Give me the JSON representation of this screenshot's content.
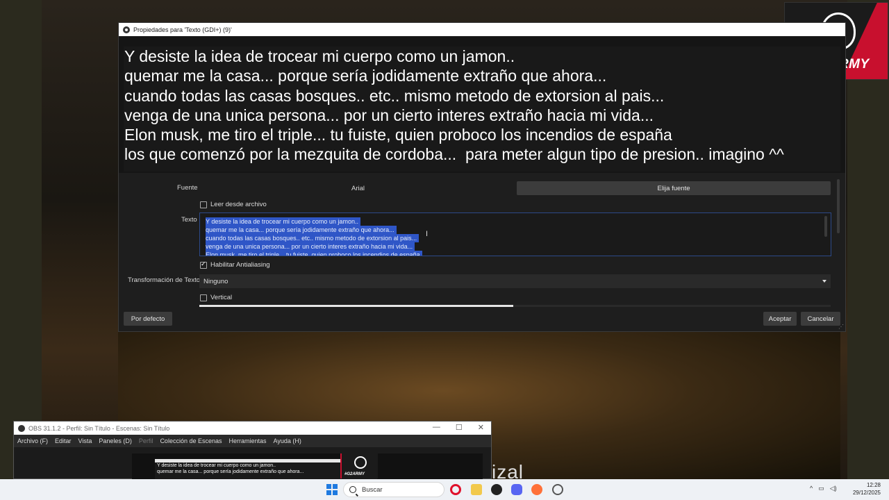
{
  "dialog": {
    "title": "Propiedades para 'Texto (GDI+) (9)'",
    "preview_text": "Y desiste la idea de trocear mi cuerpo como un jamon..\nquemar me la casa... porque sería jodidamente extraño que ahora...\ncuando todas las casas bosques.. etc.. mismo metodo de extorsion al pais...\nvenga de una unica persona... por un cierto interes extraño hacia mi vida...\nElon musk, me tiro el triple... tu fuiste, quien proboco los incendios de españa\nlos que comenzó por la mezquita de cordoba...  para meter algun tipo de presion.. imagino ^^",
    "font_label": "Fuente",
    "font_value": "Arial",
    "choose_font_button": "Elija fuente",
    "read_from_file_label": "Leer desde archivo",
    "text_label": "Texto",
    "text_lines": [
      "Y desiste la idea de trocear mi cuerpo como un jamon..",
      "quemar me la casa... porque sería jodidamente extraño que ahora...",
      "cuando todas las casas bosques.. etc.. mismo metodo de extorsion al pais...",
      "venga de una unica persona... por un cierto interes extraño hacia mi vida...",
      "Elon musk, me tiro el triple... tu fuiste, quien proboco los incendios de españa"
    ],
    "antialiasing_label": "Habilitar Antialiasing",
    "antialiasing_checked": true,
    "transform_label": "Transformación de Texto",
    "transform_value": "Ninguno",
    "vertical_label": "Vertical",
    "vertical_checked": false,
    "defaults_button": "Por defecto",
    "accept_button": "Aceptar",
    "cancel_button": "Cancelar"
  },
  "logo": {
    "tag": "#G2ARMY"
  },
  "obs_window": {
    "title": "OBS 31.1.2 - Perfil: Sin Título - Escenas: Sin Título",
    "menu": [
      "Archivo (F)",
      "Editar",
      "Vista",
      "Paneles (D)",
      "Perfil",
      "Colección de Escenas",
      "Herramientas",
      "Ayuda (H)"
    ],
    "preview_lines": [
      "Y desiste la idea de trocear mi cuerpo como un jamon..",
      "quemar me la casa... porque sería jodidamente extraño que ahora..."
    ],
    "mini_logo_tag": "#G2ARMY"
  },
  "overlay_text": "izal",
  "taskbar": {
    "search_placeholder": "Buscar",
    "time": "12:28",
    "date": "29/12/2025"
  }
}
